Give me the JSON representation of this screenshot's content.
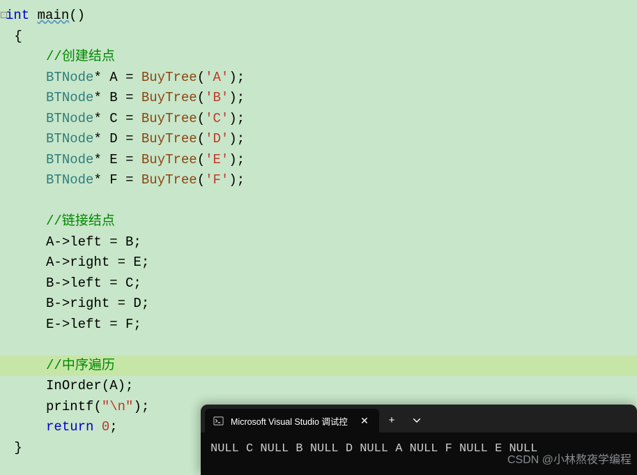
{
  "code": {
    "keyword_int": "int",
    "main": "main",
    "parens": "()",
    "brace_open": "{",
    "brace_close": "}",
    "comment_create": "//创建结点",
    "comment_link": "//链接结点",
    "comment_traverse": "//中序遍历",
    "lines_create": [
      {
        "type": "BTNode",
        "var": "A",
        "fn": "BuyTree",
        "ch": "'A'"
      },
      {
        "type": "BTNode",
        "var": "B",
        "fn": "BuyTree",
        "ch": "'B'"
      },
      {
        "type": "BTNode",
        "var": "C",
        "fn": "BuyTree",
        "ch": "'C'"
      },
      {
        "type": "BTNode",
        "var": "D",
        "fn": "BuyTree",
        "ch": "'D'"
      },
      {
        "type": "BTNode",
        "var": "E",
        "fn": "BuyTree",
        "ch": "'E'"
      },
      {
        "type": "BTNode",
        "var": "F",
        "fn": "BuyTree",
        "ch": "'F'"
      }
    ],
    "link_lines": [
      "A->left = B;",
      "A->right = E;",
      "B->left = C;",
      "B->right = D;",
      "E->left = F;"
    ],
    "inorder_call": "InOrder",
    "inorder_arg": "A",
    "printf_name": "printf",
    "printf_arg": "\"\\n\"",
    "return_kw": "return",
    "return_val": "0"
  },
  "terminal": {
    "tab_title": "Microsoft Visual Studio 调试控",
    "output": "NULL C NULL B NULL D NULL A NULL F NULL E NULL"
  },
  "watermark": "CSDN @小林熬夜学编程"
}
